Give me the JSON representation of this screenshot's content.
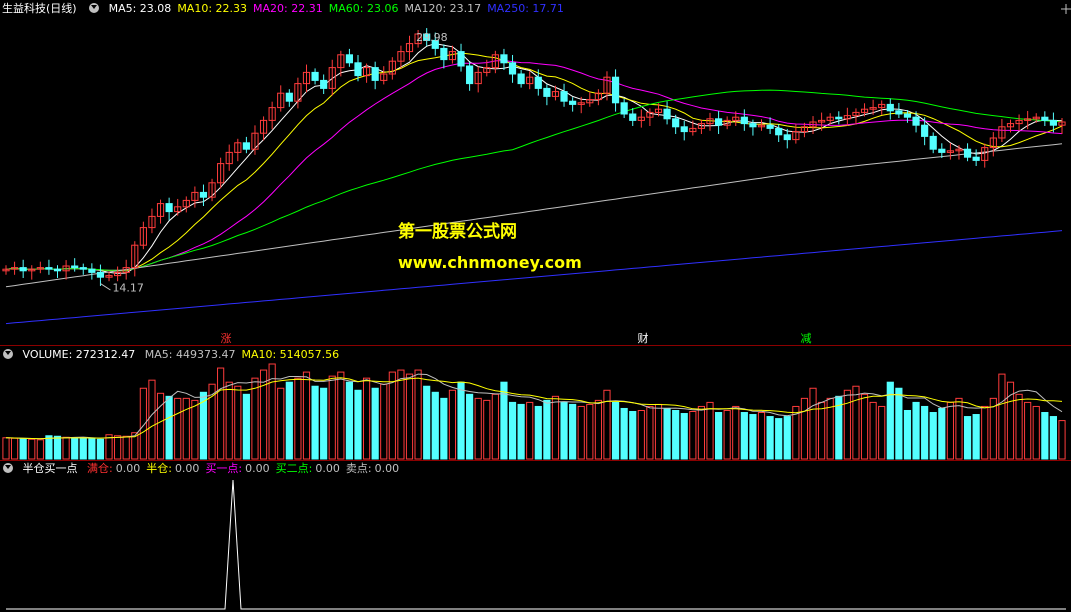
{
  "legend_main": {
    "stock": "生益科技(日线)",
    "items": [
      {
        "label": "MA5: 23.08",
        "color": "#ffffff"
      },
      {
        "label": "MA10: 22.33",
        "color": "#ffff00"
      },
      {
        "label": "MA20: 22.31",
        "color": "#ff00ff"
      },
      {
        "label": "MA60: 23.06",
        "color": "#00ff00"
      },
      {
        "label": "MA120: 23.17",
        "color": "#c0c0c0"
      },
      {
        "label": "MA250: 17.71",
        "color": "#3030ff"
      }
    ]
  },
  "legend_volume": {
    "title": "VOLUME: 272312.47",
    "items": [
      {
        "label": "MA5: 449373.47",
        "color": "#c0c0c0"
      },
      {
        "label": "MA10: 514057.56",
        "color": "#ffff00"
      }
    ]
  },
  "legend_indicator": {
    "title": "半仓买一点",
    "items": [
      {
        "label": "满仓:",
        "value": "0.00",
        "color": "#ff3030"
      },
      {
        "label": "半仓:",
        "value": "0.00",
        "color": "#ffff00"
      },
      {
        "label": "买一点:",
        "value": "0.00",
        "color": "#ff00ff"
      },
      {
        "label": "买二点:",
        "value": "0.00",
        "color": "#00ff00"
      },
      {
        "label": "卖点:",
        "value": "0.00",
        "color": "#c0c0c0"
      }
    ]
  },
  "markers": [
    {
      "text": "涨",
      "color": "#ff3030"
    },
    {
      "text": "财",
      "color": "#ffffff"
    },
    {
      "text": "减",
      "color": "#00ff00"
    }
  ],
  "watermark": {
    "line1": "第一股票公式网",
    "line2": "www.chnmoney.com"
  },
  "colors": {
    "up": "#ff3c3c",
    "down": "#54ffff",
    "separator": "#8b0000"
  },
  "chart_data": [
    {
      "type": "candlestick",
      "price_high_label": "29.98",
      "price_low_label": "14.17",
      "closes": [
        15.3,
        15.4,
        15.2,
        15.3,
        15.4,
        15.3,
        15.2,
        15.5,
        15.4,
        15.3,
        15.1,
        14.8,
        14.9,
        15.1,
        15.4,
        16.8,
        17.9,
        18.6,
        19.4,
        18.9,
        19.2,
        19.6,
        20.1,
        19.8,
        20.7,
        21.9,
        22.6,
        23.2,
        22.8,
        23.8,
        24.6,
        25.4,
        26.3,
        25.8,
        26.9,
        27.6,
        27.1,
        26.6,
        27.9,
        28.7,
        28.2,
        27.4,
        27.9,
        27.1,
        27.5,
        28.3,
        28.9,
        29.4,
        30.0,
        29.6,
        29.1,
        28.4,
        28.9,
        28.0,
        26.9,
        27.6,
        27.9,
        28.7,
        28.2,
        27.5,
        26.9,
        27.3,
        26.6,
        26.1,
        26.4,
        25.8,
        25.6,
        25.7,
        25.9,
        26.3,
        27.3,
        25.7,
        25.0,
        24.6,
        24.8,
        25.1,
        25.3,
        24.7,
        24.2,
        23.9,
        24.1,
        24.4,
        24.7,
        24.3,
        24.6,
        24.8,
        24.4,
        24.2,
        24.3,
        24.1,
        23.7,
        23.4,
        23.9,
        24.2,
        24.5,
        24.6,
        24.8,
        24.7,
        24.9,
        25.1,
        25.3,
        25.4,
        25.6,
        25.2,
        25.0,
        24.8,
        24.3,
        23.6,
        22.8,
        22.6,
        22.7,
        22.8,
        22.3,
        22.1,
        22.9,
        23.5,
        24.2,
        24.4,
        24.6,
        24.7,
        24.8,
        24.6,
        24.3,
        24.5
      ],
      "ma250_range": [
        11.9,
        17.71
      ]
    },
    {
      "type": "bar",
      "name": "VOLUME",
      "values": [
        210,
        205,
        200,
        195,
        190,
        230,
        225,
        215,
        210,
        205,
        200,
        195,
        240,
        230,
        225,
        260,
        700,
        780,
        650,
        620,
        600,
        600,
        580,
        660,
        740,
        900,
        760,
        720,
        640,
        800,
        880,
        940,
        700,
        760,
        800,
        860,
        720,
        700,
        820,
        860,
        760,
        680,
        800,
        700,
        740,
        860,
        880,
        840,
        880,
        720,
        660,
        600,
        680,
        760,
        640,
        600,
        580,
        640,
        760,
        560,
        540,
        560,
        520,
        580,
        620,
        560,
        540,
        520,
        540,
        580,
        680,
        560,
        500,
        470,
        480,
        520,
        540,
        500,
        480,
        450,
        470,
        520,
        560,
        460,
        480,
        520,
        460,
        440,
        460,
        420,
        400,
        420,
        520,
        600,
        700,
        560,
        600,
        620,
        680,
        720,
        640,
        560,
        520,
        760,
        700,
        480,
        560,
        520,
        460,
        500,
        560,
        600,
        420,
        440,
        520,
        600,
        840,
        760,
        640,
        560,
        520,
        460,
        420,
        380
      ],
      "ma5_label": "449373.47",
      "ma10_label": "514057.56"
    },
    {
      "type": "line",
      "name": "半仓买一点",
      "values": [
        0,
        0,
        0,
        0,
        0,
        0,
        0,
        0,
        0,
        0,
        0,
        0,
        0,
        0,
        0,
        0,
        0,
        0,
        0,
        0,
        0,
        0,
        0,
        0,
        0,
        0,
        0,
        0,
        0,
        0,
        0,
        0,
        0,
        0,
        0,
        1,
        0,
        0,
        0,
        0
      ]
    }
  ]
}
